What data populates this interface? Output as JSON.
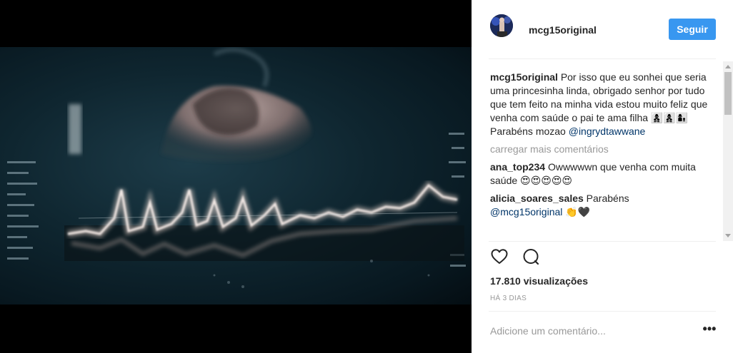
{
  "post": {
    "username": "mcg15original",
    "follow_label": "Seguir",
    "caption_user": "mcg15original",
    "caption_text": "Por isso que eu sonhei que seria uma princesinha linda, obrigado senhor por tudo que tem feito na minha vida estou muito feliz que venha com saúde o pai te ama filha 👩‍👦‍👦👩‍👦‍👦👩‍👦",
    "caption_line2": "Parabéns mozao",
    "caption_mention": "@ingrydtawwane",
    "load_more_label": "carregar mais comentários"
  },
  "comments": [
    {
      "user": "ana_top234",
      "text": "Owwwwwn que venha com muita saúde 😍😍😍😍😍"
    },
    {
      "user": "alicia_soares_sales",
      "text": "Parabéns",
      "mention": "@mcg15original",
      "emoji": "👏🖤"
    }
  ],
  "stats": {
    "views": "17.810 visualizações",
    "timestamp": "HÁ 3 DIAS"
  },
  "input": {
    "placeholder": "Adicione um comentário..."
  },
  "icons": {
    "like": "heart-icon",
    "comment": "speech-bubble-icon",
    "more": "more-options-icon"
  },
  "colors": {
    "follow_button": "#3897f0",
    "mention": "#003569",
    "muted": "#999999"
  }
}
